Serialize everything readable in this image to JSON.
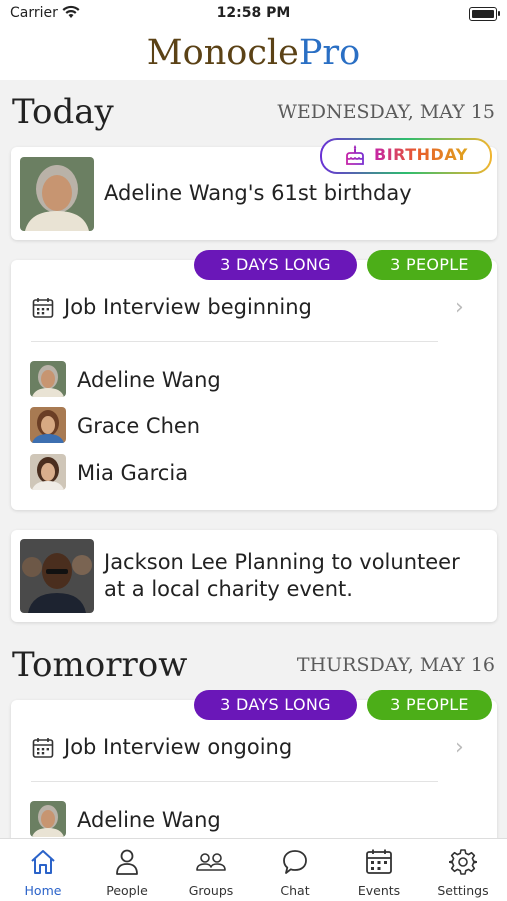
{
  "status_bar": {
    "carrier": "Carrier",
    "time": "12:58 PM"
  },
  "app": {
    "logo_part1": "Monocle",
    "logo_part2": "Pro",
    "logo_colors": {
      "part1": "#5b4216",
      "part2": "#2a6fc4"
    }
  },
  "today": {
    "title": "Today",
    "date": "WEDNESDAY, MAY 15",
    "birthday": {
      "badge": "BIRTHDAY",
      "text": "Adeline Wang's 61st birthday"
    },
    "event": {
      "duration_badge": "3 DAYS LONG",
      "people_badge": "3 PEOPLE",
      "title": "Job Interview beginning",
      "people": [
        "Adeline Wang",
        "Grace Chen",
        "Mia Garcia"
      ]
    },
    "note": {
      "text_line1": "Jackson Lee Planning to volunteer",
      "text_line2": "at a local charity event."
    }
  },
  "tomorrow": {
    "title": "Tomorrow",
    "date": "THURSDAY, MAY 16",
    "event": {
      "duration_badge": "3 DAYS LONG",
      "people_badge": "3 PEOPLE",
      "title": "Job Interview ongoing",
      "people": [
        "Adeline Wang"
      ]
    }
  },
  "tabs": [
    {
      "label": "Home",
      "icon": "home-icon",
      "active": true
    },
    {
      "label": "People",
      "icon": "person-icon"
    },
    {
      "label": "Groups",
      "icon": "group-icon"
    },
    {
      "label": "Chat",
      "icon": "chat-icon"
    },
    {
      "label": "Events",
      "icon": "calendar-icon"
    },
    {
      "label": "Settings",
      "icon": "gear-icon"
    }
  ],
  "colors": {
    "accent": "#2b63c9",
    "purple_badge": "#6a17b8",
    "green_badge": "#4cae18"
  }
}
